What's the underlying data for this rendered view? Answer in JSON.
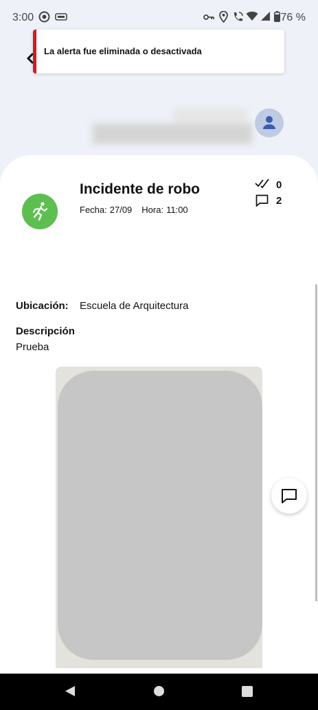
{
  "status_bar": {
    "time": "3:00",
    "battery": "76 %",
    "icons": [
      "record-icon",
      "cast-icon",
      "key-icon",
      "location-icon",
      "wifi-calling-icon",
      "wifi-icon",
      "signal-icon",
      "battery-icon"
    ]
  },
  "toast": {
    "message": "La alerta fue eliminada o desactivada",
    "accent_color": "#d71920"
  },
  "incident": {
    "title": "Incidente de robo",
    "date_label": "Fecha:",
    "date_value": "27/09",
    "time_label": "Hora:",
    "time_value": "11:00",
    "category_icon": "running-person-icon",
    "category_color": "#5cbf4f",
    "confirmations": "0",
    "comments": "2",
    "location_label": "Ubicación:",
    "location_value": "Escuela de Arquitectura",
    "description_label": "Descripción",
    "description_value": "Prueba"
  },
  "nav_bar": {
    "icons": [
      "back-triangle-icon",
      "home-circle-icon",
      "recents-square-icon"
    ]
  }
}
